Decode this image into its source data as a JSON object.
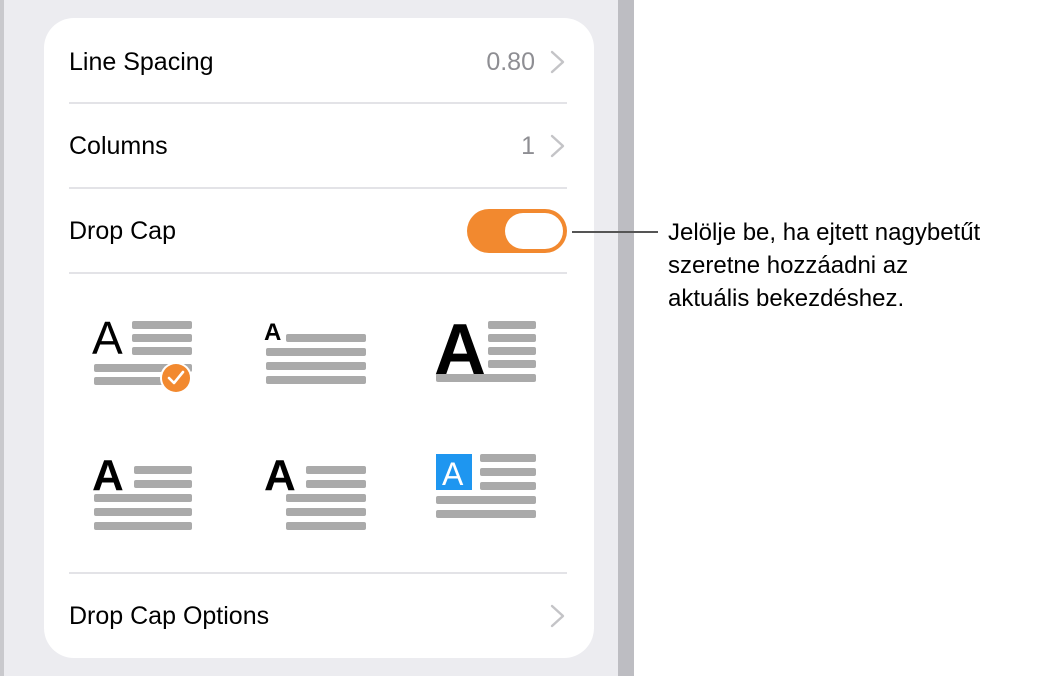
{
  "settings": {
    "line_spacing": {
      "label": "Line Spacing",
      "value": "0.80"
    },
    "columns": {
      "label": "Columns",
      "value": "1"
    },
    "drop_cap": {
      "label": "Drop Cap",
      "enabled": true
    },
    "drop_cap_options": {
      "label": "Drop Cap Options"
    }
  },
  "drop_cap_styles": [
    {
      "glyph": "A",
      "selected": true
    },
    {
      "glyph": "A",
      "selected": false
    },
    {
      "glyph": "A",
      "selected": false
    },
    {
      "glyph": "A",
      "selected": false
    },
    {
      "glyph": "A",
      "selected": false
    },
    {
      "glyph": "A",
      "selected": false
    }
  ],
  "callout": {
    "text": "Jelölje be, ha ejtett nagybetűt\nszeretne hozzáadni az\naktuális bekezdéshez."
  },
  "colors": {
    "accent": "#F2892F",
    "highlight_blue": "#1E96F0",
    "line_gray": "#AAAAAA"
  }
}
